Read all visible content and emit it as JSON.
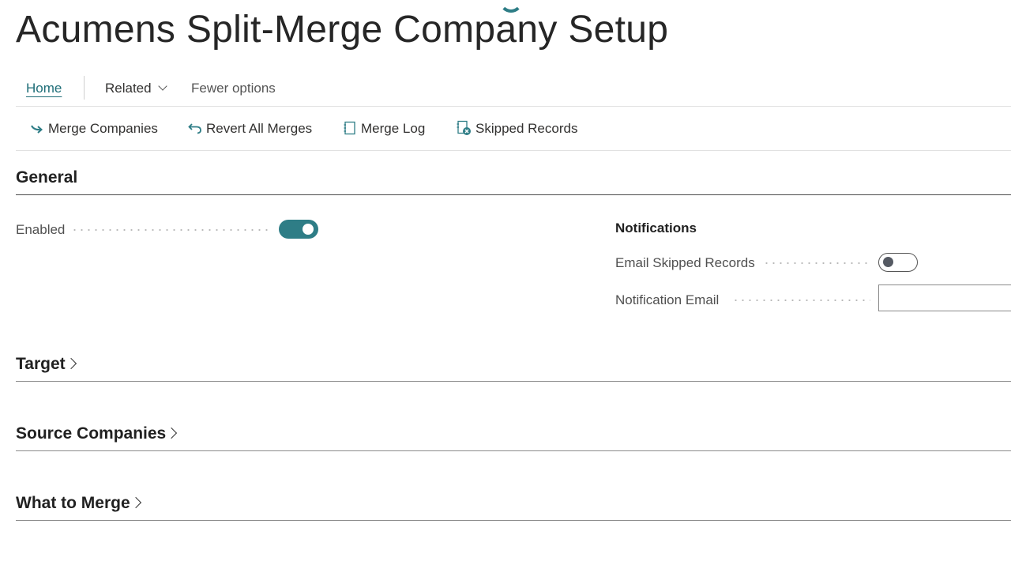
{
  "page": {
    "title": "Acumens Split-Merge Company Setup"
  },
  "nav": {
    "home": "Home",
    "related": "Related",
    "fewer_options": "Fewer options"
  },
  "actions": [
    {
      "label": "Merge Companies",
      "icon": "merge-arrow-icon"
    },
    {
      "label": "Revert All Merges",
      "icon": "undo-icon"
    },
    {
      "label": "Merge Log",
      "icon": "notebook-icon"
    },
    {
      "label": "Skipped Records",
      "icon": "skipped-records-icon"
    }
  ],
  "sections": {
    "general": {
      "title": "General",
      "enabled_label": "Enabled",
      "enabled_value": true,
      "notifications": {
        "title": "Notifications",
        "email_skipped_label": "Email Skipped Records",
        "email_skipped_value": false,
        "notification_email_label": "Notification Email",
        "notification_email_value": ""
      }
    },
    "target": {
      "title": "Target"
    },
    "source_companies": {
      "title": "Source Companies"
    },
    "what_to_merge": {
      "title": "What to Merge"
    }
  },
  "colors": {
    "accent": "#2e7d86",
    "text": "#212121",
    "label": "#505050"
  }
}
